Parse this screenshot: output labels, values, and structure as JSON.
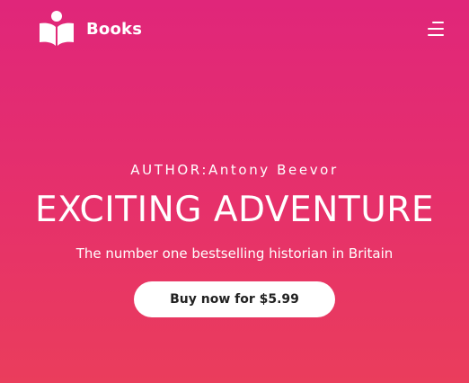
{
  "header": {
    "brand": "Books",
    "logo_icon": "book-reader-icon",
    "menu_icon": "hamburger-menu-icon"
  },
  "hero": {
    "author": "AUTHOR:Antony Beevor",
    "title": "EXCITING ADVENTURE",
    "subtitle": "The number one bestselling historian in Britain",
    "cta_label": "Buy now for $5.99"
  },
  "colors": {
    "gradient_top": "#e0267a",
    "gradient_bottom": "#ea3d5c",
    "button_bg": "#ffffff",
    "button_text": "#222222"
  }
}
